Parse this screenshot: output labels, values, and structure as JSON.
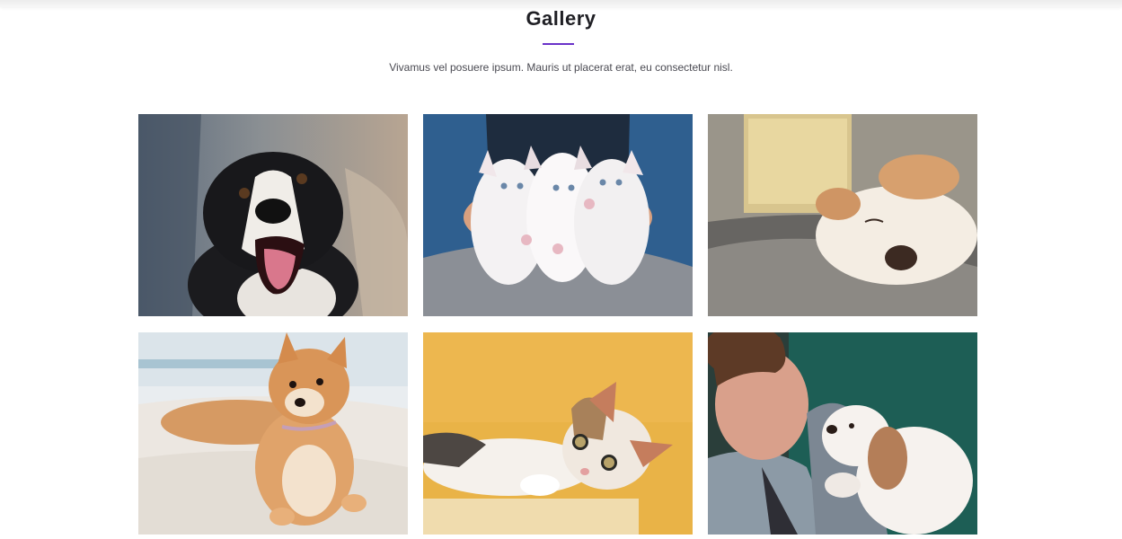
{
  "gallery": {
    "title": "Gallery",
    "subtitle": "Vivamus vel posuere ipsum. Mauris ut placerat erat, eu consectetur nisl.",
    "accent_color": "#6a32c9",
    "images": [
      {
        "subject": "dog-border-collie"
      },
      {
        "subject": "three-kittens"
      },
      {
        "subject": "sleeping-puppy"
      },
      {
        "subject": "shiba-inu-dog"
      },
      {
        "subject": "tabby-kitten"
      },
      {
        "subject": "woman-with-puppy"
      }
    ]
  }
}
